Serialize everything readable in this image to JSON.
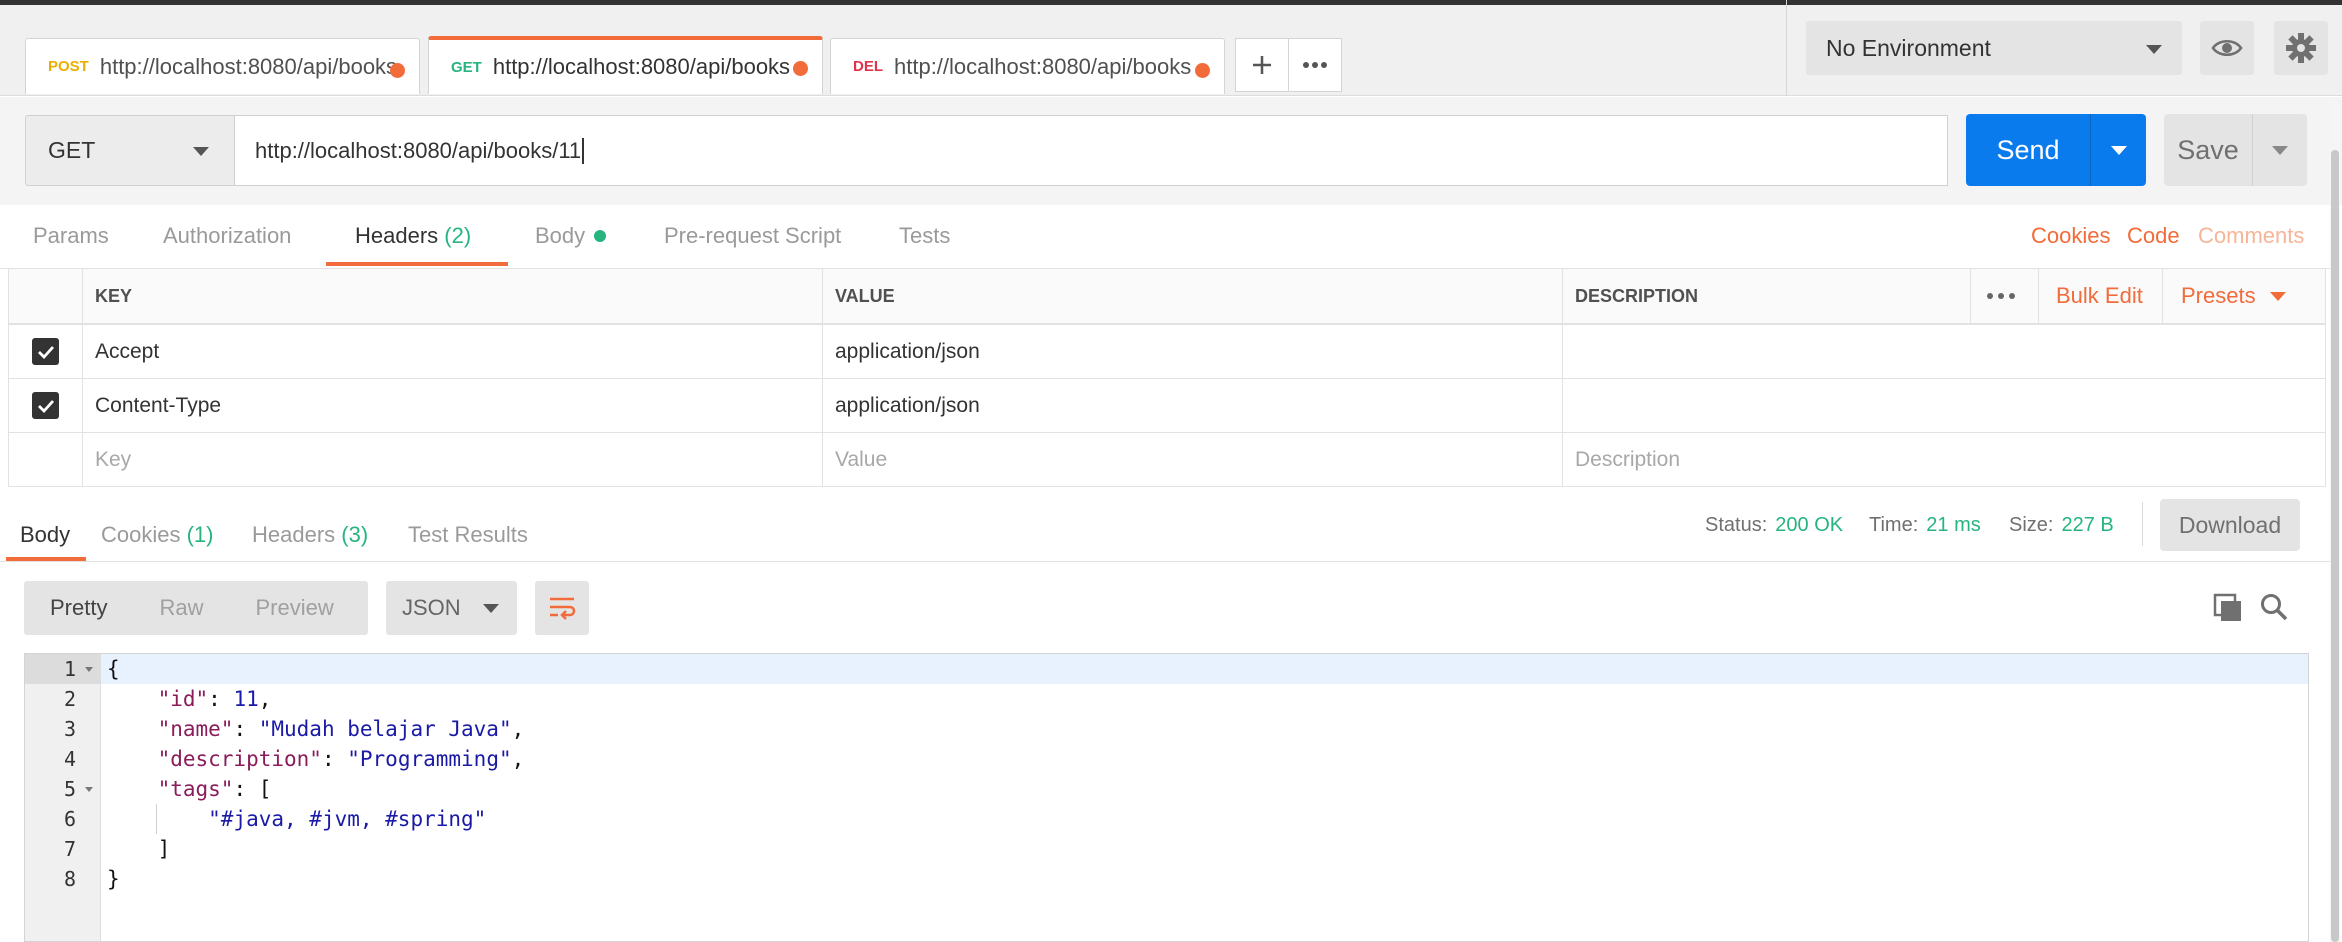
{
  "tabs": [
    {
      "method": "POST",
      "method_color": "#e9b000",
      "url": "http://localhost:8080/api/books"
    },
    {
      "method": "GET",
      "method_color": "#26b47f",
      "url": "http://localhost:8080/api/books"
    },
    {
      "method": "DEL",
      "method_color": "#e0334e",
      "url": "http://localhost:8080/api/books"
    }
  ],
  "tab_actions": {
    "new_tab_icon": "plus-icon",
    "more_icon": "ellipsis-icon"
  },
  "environment": {
    "selected": "No Environment",
    "eye_icon": "eye-icon",
    "settings_icon": "gear-icon"
  },
  "request": {
    "method": "GET",
    "url": "http://localhost:8080/api/books/11",
    "send_label": "Send",
    "save_label": "Save"
  },
  "request_tabs": {
    "params": "Params",
    "authorization": "Authorization",
    "headers": "Headers",
    "headers_count": "(2)",
    "body": "Body",
    "pre_request": "Pre-request Script",
    "tests": "Tests",
    "cookies": "Cookies",
    "code": "Code",
    "comments": "Comments"
  },
  "headers_table": {
    "col_key": "KEY",
    "col_value": "VALUE",
    "col_description": "DESCRIPTION",
    "bulk_edit": "Bulk Edit",
    "presets": "Presets",
    "rows": [
      {
        "key": "Accept",
        "value": "application/json",
        "checked": true
      },
      {
        "key": "Content-Type",
        "value": "application/json",
        "checked": true
      }
    ],
    "placeholder_key": "Key",
    "placeholder_value": "Value",
    "placeholder_description": "Description"
  },
  "response_tabs": {
    "body": "Body",
    "cookies": "Cookies",
    "cookies_count": "(1)",
    "headers": "Headers",
    "headers_count": "(3)",
    "test_results": "Test Results"
  },
  "response_status": {
    "status_label": "Status:",
    "status_value": "200 OK",
    "time_label": "Time:",
    "time_value": "21 ms",
    "size_label": "Size:",
    "size_value": "227 B",
    "download": "Download"
  },
  "response_view": {
    "pretty": "Pretty",
    "raw": "Raw",
    "preview": "Preview",
    "format": "JSON"
  },
  "code_lines": [
    {
      "num": "1",
      "text": "{"
    },
    {
      "num": "2",
      "key": "\"id\"",
      "val": "11",
      "tail": ","
    },
    {
      "num": "3",
      "key": "\"name\"",
      "val": "\"Mudah belajar Java\"",
      "tail": ","
    },
    {
      "num": "4",
      "key": "\"description\"",
      "val": "\"Programming\"",
      "tail": ","
    },
    {
      "num": "5",
      "key": "\"tags\"",
      "tail": "["
    },
    {
      "num": "6",
      "val": "\"#java, #jvm, #spring\""
    },
    {
      "num": "7",
      "text": "]"
    },
    {
      "num": "8",
      "text": "}"
    }
  ]
}
